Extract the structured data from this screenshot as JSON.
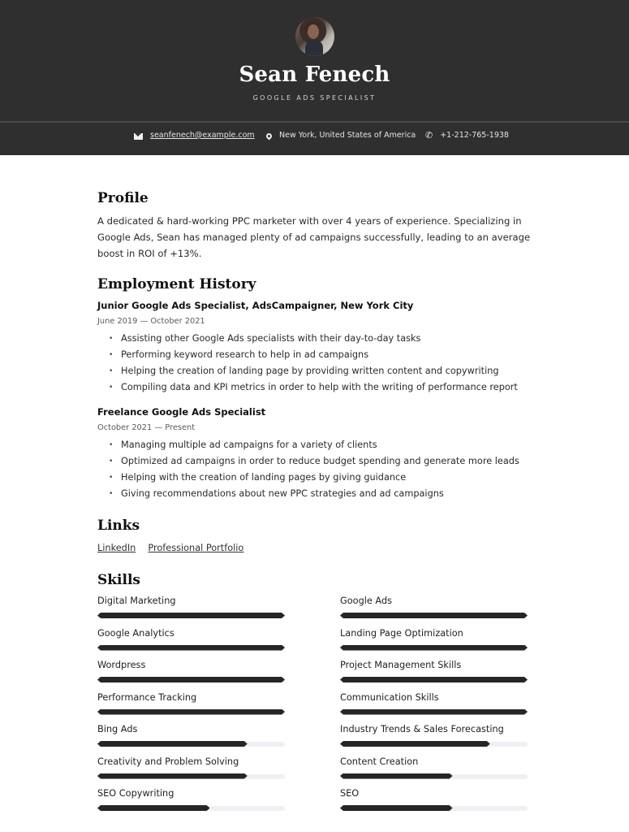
{
  "header": {
    "name": "Sean Fenech",
    "job_title": "GOOGLE ADS SPECIALIST",
    "avatar": "profile-photo"
  },
  "contact": {
    "email": "seanfenech@example.com",
    "location": "New York, United States of America",
    "phone": "+1-212-765-1938",
    "icons": {
      "email": "mail-icon",
      "location": "map-pin-icon",
      "phone": "phone-icon"
    }
  },
  "profile": {
    "heading": "Profile",
    "text": "A dedicated & hard-working PPC marketer with over 4 years of experience. Specializing in Google Ads, Sean has managed plenty of ad campaigns successfully, leading to an average boost in ROI of +13%."
  },
  "employment": {
    "heading": "Employment History",
    "jobs": [
      {
        "title": "Junior Google Ads Specialist, AdsCampaigner, New York City",
        "dates": "June 2019 — October 2021",
        "bullets": [
          "Assisting other Google Ads specialists with their day-to-day tasks",
          "Performing keyword research to help in ad campaigns",
          "Helping the creation of landing page by providing written content and copywriting",
          "Compiling data and KPI metrics in order to help with the writing of performance report"
        ]
      },
      {
        "title": "Freelance Google Ads Specialist",
        "dates": "October 2021 — Present",
        "bullets": [
          "Managing multiple ad campaigns for a variety of clients",
          "Optimized ad campaigns in order to reduce budget spending and generate more leads",
          "Helping with the creation of landing pages by giving guidance",
          "Giving recommendations about new PPC strategies and ad campaigns"
        ]
      }
    ]
  },
  "links": {
    "heading": "Links",
    "items": [
      "LinkedIn",
      "Professional Portfolio"
    ]
  },
  "skills": {
    "heading": "Skills",
    "left": [
      {
        "label": "Digital Marketing",
        "level": 1.0
      },
      {
        "label": "Google Analytics",
        "level": 1.0
      },
      {
        "label": "Wordpress",
        "level": 1.0
      },
      {
        "label": "Performance Tracking",
        "level": 1.0
      },
      {
        "label": "Bing Ads",
        "level": 0.8
      },
      {
        "label": "Creativity and Problem Solving",
        "level": 0.8
      },
      {
        "label": "SEO Copywriting",
        "level": 0.6
      }
    ],
    "right": [
      {
        "label": "Google Ads",
        "level": 1.0
      },
      {
        "label": "Landing Page Optimization",
        "level": 1.0
      },
      {
        "label": "Project Management Skills",
        "level": 1.0
      },
      {
        "label": "Communication Skills",
        "level": 1.0
      },
      {
        "label": "Industry Trends & Sales Forecasting",
        "level": 0.8
      },
      {
        "label": "Content Creation",
        "level": 0.6
      },
      {
        "label": "SEO",
        "level": 0.6
      }
    ]
  },
  "colors": {
    "header_bg": "#2f2f2f",
    "bar_fill": "#262626",
    "bar_track": "#eef0f4"
  }
}
